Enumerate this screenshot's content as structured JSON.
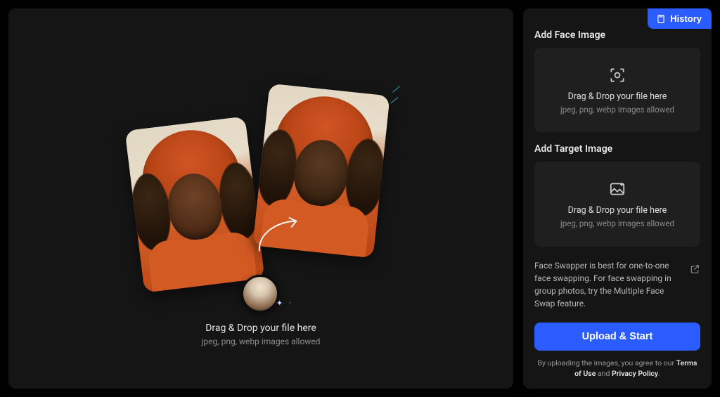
{
  "header": {
    "history_button": "History"
  },
  "main": {
    "drop_line1": "Drag & Drop your file here",
    "drop_line2": "jpeg, png, webp images allowed"
  },
  "side": {
    "face": {
      "title": "Add Face Image",
      "drop_line1": "Drag & Drop your file here",
      "drop_line2": "jpeg, png, webp images allowed"
    },
    "target": {
      "title": "Add Target Image",
      "drop_line1": "Drag & Drop your file here",
      "drop_line2": "jpeg, png, webp images allowed"
    },
    "hint": "Face Swapper is best for one-to-one face swapping. For face swapping in group photos, try the Multiple Face Swap feature.",
    "primary_button": "Upload & Start",
    "legal_prefix": "By uploading the images, you agree to our ",
    "legal_terms": "Terms of Use",
    "legal_and": " and ",
    "legal_privacy": "Privacy Policy",
    "legal_suffix": "."
  }
}
